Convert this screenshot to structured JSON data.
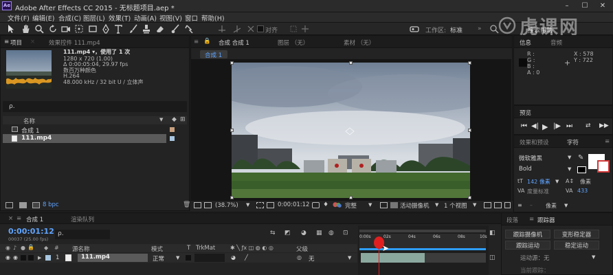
{
  "window": {
    "title": "Adobe After Effects CC 2015 - 无标题项目.aep *",
    "app_icon": "Ae",
    "minimize": "–",
    "maximize": "☐",
    "close": "✕"
  },
  "menu": [
    "文件(F)",
    "编辑(E)",
    "合成(C)",
    "图层(L)",
    "效果(T)",
    "动画(A)",
    "视图(V)",
    "窗口",
    "帮助(H)"
  ],
  "toolbar": {
    "snap_label": "对齐",
    "workspace_label": "工作区:",
    "workspace_value": "标准",
    "search_help": "搜索帮助"
  },
  "watermark": "虎课网",
  "project": {
    "tab_project": "项目",
    "tab_effects": "效果控件 111.mp4",
    "item_name": "111.mp4 ▾，使用了 1 次",
    "props": [
      "1280 x 720 (1.00)",
      "Δ 0:00:05:04, 29.97 fps",
      "数百万种颜色",
      "H.264",
      "48.000 kHz / 32 bit U / 立体声"
    ],
    "search_placeholder": "ρ.",
    "col_name": "名称",
    "items": [
      {
        "name": "合成 1",
        "type": "comp"
      },
      {
        "name": "111.mp4",
        "type": "footage"
      }
    ],
    "bpc": "8 bpc"
  },
  "viewer": {
    "tab_comp": "合成 合成 1",
    "tab_layer": "图层 （无）",
    "tab_footage": "素材 （无）",
    "comp_chip": "合成 1",
    "zoom": "(38.7%)",
    "timecode": "0:00:01:12",
    "quality": "完整",
    "camera": "活动摄像机",
    "views": "1 个视图"
  },
  "info": {
    "tab_info": "信息",
    "tab_audio": "音频",
    "r": "R :",
    "g": "G :",
    "b": "B :",
    "a": "A : 0",
    "x": "X : 578",
    "y": "Y : 722"
  },
  "preview": {
    "tab": "预览"
  },
  "character": {
    "tab_effects": "效果和预设",
    "tab_char": "字符",
    "font": "微软雅黑",
    "style": "Bold",
    "size": "142 像素",
    "size2": "像素",
    "leading_label": "度量标准",
    "tracking": "433",
    "unit": "像素"
  },
  "tracker": {
    "tab_paragraph": "段落",
    "tab_tracker": "跟踪器",
    "track_camera": "跟踪摄像机",
    "warp_stabilizer": "变形稳定器",
    "track_motion": "跟踪运动",
    "stabilize_motion": "稳定运动",
    "source_label": "运动源：无",
    "current_track": "当前跟踪："
  },
  "timeline": {
    "tab_comp": "合成 1",
    "tab_render": "渲染队列",
    "timecode": "0:00:01:12",
    "frames": "00037 (25.00 fps)",
    "search_placeholder": "ρ.",
    "col_source": "源名称",
    "col_mode": "模式",
    "col_t": "T",
    "col_trkmat": "TrkMat",
    "col_parent": "父级",
    "layer_num": "1",
    "layer_name": "111.mp4",
    "layer_mode": "正常",
    "layer_parent": "无",
    "ruler": [
      "0:00s",
      "02s",
      "04s",
      "06s",
      "08s",
      "10s"
    ]
  }
}
